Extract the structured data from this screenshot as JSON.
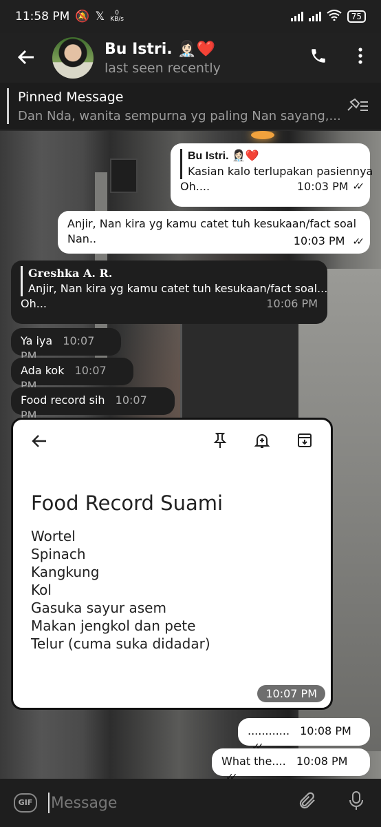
{
  "status": {
    "time": "11:58 PM",
    "net_speed": "0",
    "net_unit": "KB/s",
    "battery": "75"
  },
  "header": {
    "name": "Bu Istri. 👩🏻‍⚕️❤️",
    "last_seen": "last seen recently"
  },
  "pinned": {
    "title": "Pinned Message",
    "text": "Dan Nda, wanita sempurna yg paling Nan sayang,..."
  },
  "messages": [
    {
      "quote_name": "Bu Istri. 👩🏻‍⚕️❤️",
      "quote_text": "Kasian kalo terlupakan pasiennya",
      "text": "Oh....",
      "time": "10:03 PM",
      "ticks": "✓✓"
    },
    {
      "text": "Anjir, Nan kira yg kamu catet tuh kesukaan/fact soal Nan..",
      "time": "10:03 PM",
      "ticks": "✓✓"
    },
    {
      "quote_name": "Greshka A. R.",
      "quote_text": "Anjir, Nan kira yg kamu catet tuh kesukaan/fact soal...",
      "text": "Oh...",
      "time": "10:06 PM"
    },
    {
      "text": "Ya iya",
      "time": "10:07 PM"
    },
    {
      "text": "Ada kok",
      "time": "10:07 PM"
    },
    {
      "text": "Food record sih",
      "time": "10:07 PM"
    },
    {
      "text": "............",
      "time": "10:08 PM",
      "ticks": "✓✓"
    },
    {
      "text": "What the....",
      "time": "10:08 PM",
      "ticks": "✓✓"
    }
  ],
  "note": {
    "title": "Food Record Suami",
    "items": [
      "Wortel",
      "Spinach",
      "Kangkung",
      "Kol",
      "Gasuka sayur asem",
      "Makan jengkol dan pete",
      "Telur (cuma suka didadar)"
    ],
    "time": "10:07 PM"
  },
  "input": {
    "placeholder": "Message",
    "gif_label": "GIF"
  }
}
